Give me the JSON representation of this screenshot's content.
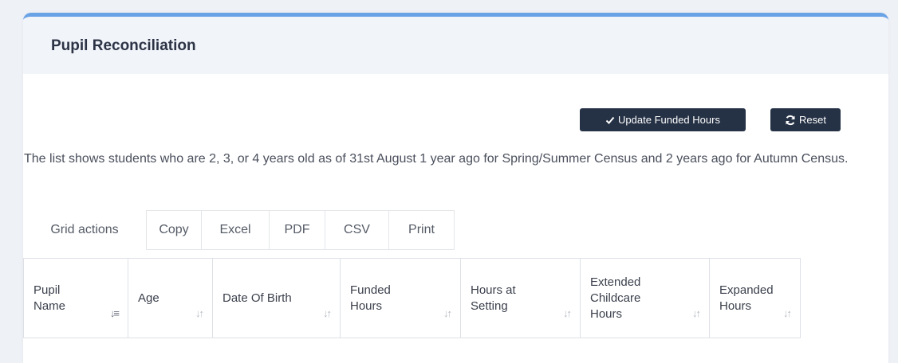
{
  "panel": {
    "title": "Pupil Reconciliation"
  },
  "actions": {
    "update_label": "Update Funded Hours",
    "reset_label": "Reset"
  },
  "info_text": "The list shows students who are 2, 3, or 4 years old as of 31st August 1 year ago for Spring/Summer Census and 2 years ago for Autumn Census.",
  "grid_actions": {
    "label": "Grid actions",
    "buttons": [
      "Copy",
      "Excel",
      "PDF",
      "CSV",
      "Print"
    ]
  },
  "table": {
    "columns": [
      {
        "label": "Pupil Name",
        "sort_icon": "sort-alpha-down-icon"
      },
      {
        "label": "Age",
        "sort_icon": "sort-icon"
      },
      {
        "label": "Date Of Birth",
        "sort_icon": "sort-icon"
      },
      {
        "label": "Funded Hours",
        "sort_icon": "sort-icon"
      },
      {
        "label": "Hours at Setting",
        "sort_icon": "sort-icon"
      },
      {
        "label": "Extended Childcare Hours",
        "sort_icon": "sort-icon"
      },
      {
        "label": "Expanded Hours",
        "sort_icon": "sort-icon"
      }
    ]
  }
}
